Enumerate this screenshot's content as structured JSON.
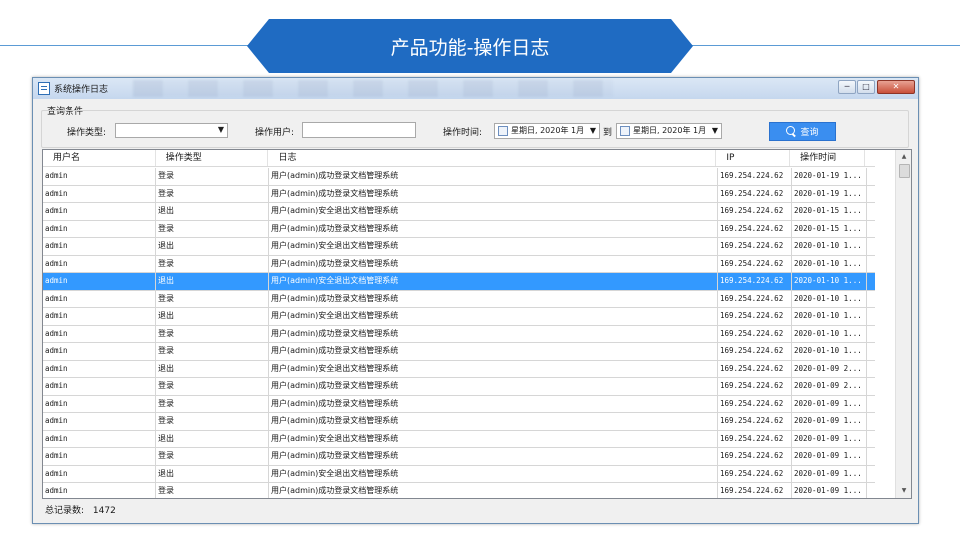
{
  "slide": {
    "title": "产品功能-操作日志"
  },
  "window": {
    "title": "系统操作日志",
    "controls": {
      "minimize": "─",
      "maximize": "□",
      "close": "✕"
    }
  },
  "query": {
    "group_label": "查询条件",
    "type_label": "操作类型:",
    "type_value": "",
    "user_label": "操作用户:",
    "user_value": "",
    "time_label": "操作时间:",
    "date_from": "星期日, 2020年 1月",
    "to_label": "到",
    "date_to": "星期日, 2020年 1月",
    "search_button": "查询"
  },
  "table": {
    "columns": [
      "用户名",
      "操作类型",
      "日志",
      "IP",
      "操作时间"
    ],
    "selected_index": 6,
    "rows": [
      [
        "admin",
        "登录",
        "用户(admin)成功登录文档管理系统",
        "169.254.224.62",
        "2020-01-19 1..."
      ],
      [
        "admin",
        "登录",
        "用户(admin)成功登录文档管理系统",
        "169.254.224.62",
        "2020-01-19 1..."
      ],
      [
        "admin",
        "退出",
        "用户(admin)安全退出文档管理系统",
        "169.254.224.62",
        "2020-01-15 1..."
      ],
      [
        "admin",
        "登录",
        "用户(admin)成功登录文档管理系统",
        "169.254.224.62",
        "2020-01-15 1..."
      ],
      [
        "admin",
        "退出",
        "用户(admin)安全退出文档管理系统",
        "169.254.224.62",
        "2020-01-10 1..."
      ],
      [
        "admin",
        "登录",
        "用户(admin)成功登录文档管理系统",
        "169.254.224.62",
        "2020-01-10 1..."
      ],
      [
        "admin",
        "退出",
        "用户(admin)安全退出文档管理系统",
        "169.254.224.62",
        "2020-01-10 1..."
      ],
      [
        "admin",
        "登录",
        "用户(admin)成功登录文档管理系统",
        "169.254.224.62",
        "2020-01-10 1..."
      ],
      [
        "admin",
        "退出",
        "用户(admin)安全退出文档管理系统",
        "169.254.224.62",
        "2020-01-10 1..."
      ],
      [
        "admin",
        "登录",
        "用户(admin)成功登录文档管理系统",
        "169.254.224.62",
        "2020-01-10 1..."
      ],
      [
        "admin",
        "登录",
        "用户(admin)成功登录文档管理系统",
        "169.254.224.62",
        "2020-01-10 1..."
      ],
      [
        "admin",
        "退出",
        "用户(admin)安全退出文档管理系统",
        "169.254.224.62",
        "2020-01-09 2..."
      ],
      [
        "admin",
        "登录",
        "用户(admin)成功登录文档管理系统",
        "169.254.224.62",
        "2020-01-09 2..."
      ],
      [
        "admin",
        "登录",
        "用户(admin)成功登录文档管理系统",
        "169.254.224.62",
        "2020-01-09 1..."
      ],
      [
        "admin",
        "登录",
        "用户(admin)成功登录文档管理系统",
        "169.254.224.62",
        "2020-01-09 1..."
      ],
      [
        "admin",
        "退出",
        "用户(admin)安全退出文档管理系统",
        "169.254.224.62",
        "2020-01-09 1..."
      ],
      [
        "admin",
        "登录",
        "用户(admin)成功登录文档管理系统",
        "169.254.224.62",
        "2020-01-09 1..."
      ],
      [
        "admin",
        "退出",
        "用户(admin)安全退出文档管理系统",
        "169.254.224.62",
        "2020-01-09 1..."
      ],
      [
        "admin",
        "登录",
        "用户(admin)成功登录文档管理系统",
        "169.254.224.62",
        "2020-01-09 1..."
      ]
    ]
  },
  "footer": {
    "total_label": "总记录数:",
    "total_value": "1472"
  }
}
